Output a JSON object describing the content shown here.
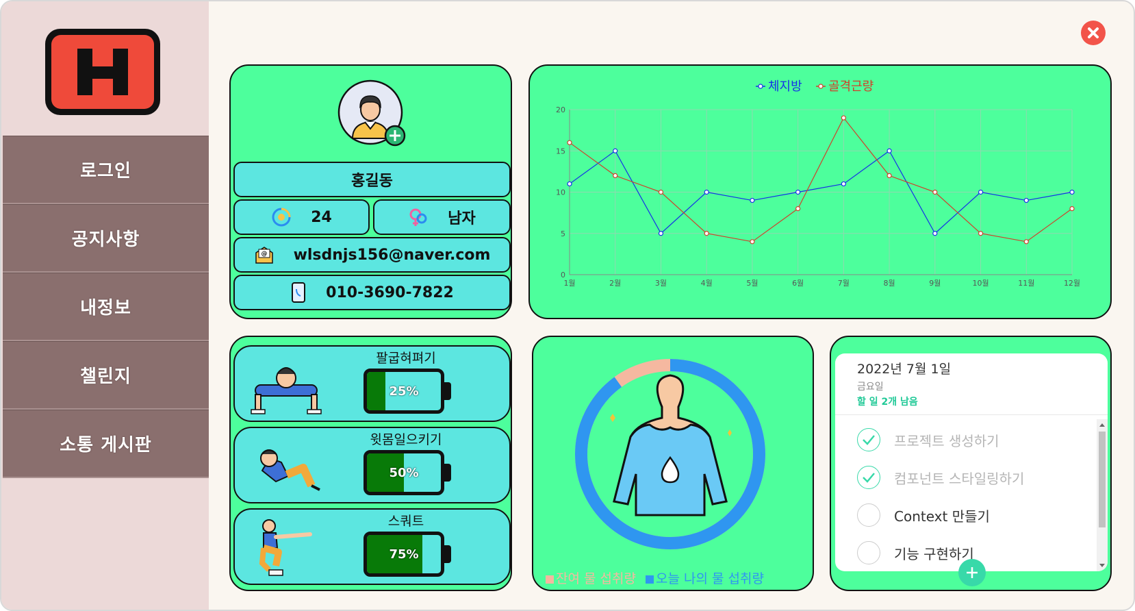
{
  "sidebar": {
    "logo_letter": "H",
    "items": [
      {
        "label": "로그인"
      },
      {
        "label": "공지사항"
      },
      {
        "label": "내정보"
      },
      {
        "label": "챌린지"
      },
      {
        "label": "소통 게시판"
      }
    ]
  },
  "profile": {
    "name": "홍길동",
    "age": "24",
    "gender": "남자",
    "email": "wlsdnjs156@naver.com",
    "phone": "010-3690-7822"
  },
  "chart_data": {
    "type": "line",
    "title": "",
    "x": [
      "1월",
      "2월",
      "3월",
      "4월",
      "5월",
      "6월",
      "7월",
      "8월",
      "9월",
      "10월",
      "11월",
      "12월"
    ],
    "ylim": [
      0,
      20
    ],
    "yticks": [
      0,
      5,
      10,
      15,
      20
    ],
    "legend_position": "top",
    "grid": true,
    "series": [
      {
        "name": "체지방",
        "color": "#1530e8",
        "values": [
          11,
          15,
          5,
          10,
          9,
          10,
          11,
          15,
          5,
          10,
          9,
          10
        ]
      },
      {
        "name": "골격근량",
        "color": "#d0402a",
        "values": [
          16,
          12,
          10,
          5,
          4,
          8,
          19,
          12,
          10,
          5,
          4,
          8
        ]
      }
    ]
  },
  "exercises": [
    {
      "title": "팔굽혀펴기",
      "percent": 25,
      "label": "25%"
    },
    {
      "title": "윗몸일으키기",
      "percent": 50,
      "label": "50%"
    },
    {
      "title": "스쿼트",
      "percent": 75,
      "label": "75%"
    }
  ],
  "water": {
    "legend_remaining": "잔여 물 섭취량",
    "legend_today": "오늘 나의 물 섭취량",
    "remaining_color": "#f5b8a0",
    "today_color": "#2f96f0",
    "today_fraction": 0.9
  },
  "todo": {
    "date": "2022년 7월 1일",
    "day": "금요일",
    "remaining": "할 일 2개 남음",
    "items": [
      {
        "text": "프로젝트 생성하기",
        "done": true
      },
      {
        "text": "컴포넌트 스타일링하기",
        "done": true
      },
      {
        "text": "Context 만들기",
        "done": false
      },
      {
        "text": "기능 구현하기",
        "done": false
      }
    ]
  },
  "colors": {
    "card": "#4dff9c",
    "pill": "#5ce6e0",
    "sidebar": "#ecd9d8",
    "menu": "#8a6f6e",
    "accent": "#38d9a9"
  }
}
